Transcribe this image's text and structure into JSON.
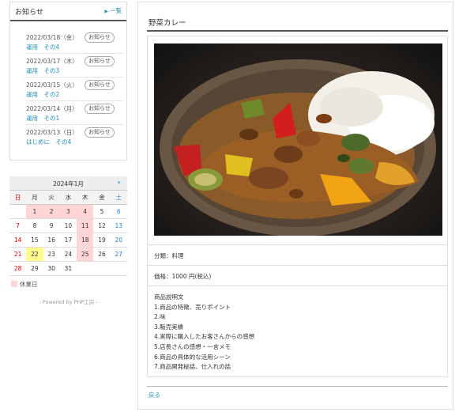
{
  "news": {
    "title": "お知らせ",
    "more_label": "一覧",
    "badge_label": "お知らせ",
    "items": [
      {
        "date": "2022/03/18（金）",
        "category": "運用　その4"
      },
      {
        "date": "2022/03/17（木）",
        "category": "運用　その3"
      },
      {
        "date": "2022/03/15（火）",
        "category": "運用　その2"
      },
      {
        "date": "2022/03/14（月）",
        "category": "運用　その1"
      },
      {
        "date": "2022/03/13（日）",
        "category": "はじめに　その4"
      }
    ]
  },
  "calendar": {
    "title": "2024年1月",
    "next_label": "»",
    "weekdays": [
      "日",
      "月",
      "火",
      "水",
      "木",
      "金",
      "土"
    ],
    "weeks": [
      [
        "",
        "1",
        "2",
        "3",
        "4",
        "5",
        "6"
      ],
      [
        "7",
        "8",
        "9",
        "10",
        "11",
        "12",
        "13"
      ],
      [
        "14",
        "15",
        "16",
        "17",
        "18",
        "19",
        "20"
      ],
      [
        "21",
        "22",
        "23",
        "24",
        "25",
        "26",
        "27"
      ],
      [
        "28",
        "29",
        "30",
        "31",
        "",
        "",
        ""
      ]
    ],
    "holidays": [
      "1",
      "2",
      "3",
      "4",
      "11",
      "18",
      "25"
    ],
    "today": "22",
    "holiday_color": "#ffd5d5",
    "today_color": "#fffb8c",
    "legend_label": "休業日"
  },
  "powered_by": "- Powered by PHP工房 -",
  "product": {
    "title": "野菜カレー",
    "category_line": "分類：料理",
    "price_line": "価格：1000 円(税込)",
    "description_heading": "商品説明文",
    "description_lines": [
      "1.商品の特徴、売りポイント",
      "2.味",
      "3.販売実績",
      "4.実際に購入したお客さんからの感想",
      "5.店長さんの感想・一言メモ",
      "6.商品の具体的な活用シーン",
      "7.商品開発秘話、仕入れの話"
    ]
  },
  "back_label": "戻る",
  "colors": {
    "link": "#2a8fb8",
    "sunday": "#d00000",
    "saturday": "#2a7fd0"
  }
}
